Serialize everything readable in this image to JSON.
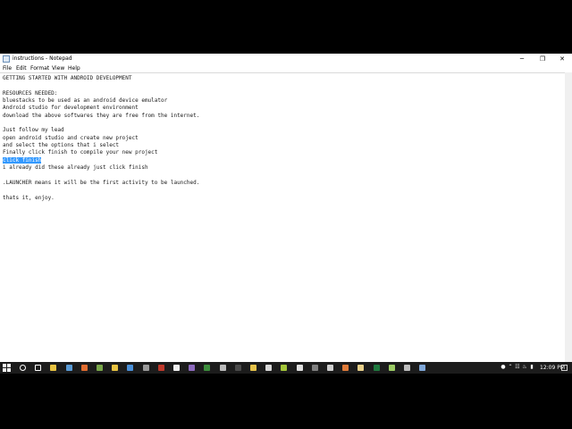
{
  "window": {
    "title": "instructions - Notepad",
    "controls": {
      "minimize": "─",
      "maximize": "❐",
      "close": "✕"
    }
  },
  "menu": {
    "file": "File",
    "edit": "Edit",
    "format": "Format",
    "view": "View",
    "help": "Help"
  },
  "document": {
    "lines": [
      "GETTING STARTED WITH ANDROID DEVELOPMENT",
      "",
      "RESOURCES NEEDED:",
      "bluestacks to be used as an android device emulator",
      "Android studio for development environment",
      "download the above softwares they are free from the internet.",
      "",
      "Just follow my lead",
      "open android studio and create new project",
      "and select the options that i select",
      "Finally click finish to compile your new project",
      "click finish",
      "i already did these already just click finish",
      "",
      ".LAUNCHER means it will be the first activity to be launched.",
      "",
      "thats it, enjoy."
    ],
    "selected_line_index": 11
  },
  "taskbar": {
    "clock": "12:09 PM",
    "colors": {
      "background": "#1c1c1c"
    },
    "icons": [
      "search-icon",
      "task-view-icon",
      "file-explorer-icon",
      "store-icon",
      "firefox-icon",
      "minecraft-icon",
      "folder-icon",
      "photos-icon",
      "calculator-icon",
      "media-icon",
      "app-icon",
      "visual-studio-icon",
      "terminal-icon",
      "settings-icon",
      "cmd-icon",
      "notes-icon",
      "files-icon",
      "android-icon",
      "paint-icon",
      "app2-icon",
      "console-icon",
      "java-icon",
      "android-studio-icon",
      "excel-icon",
      "image-icon",
      "camera-icon",
      "notepad-icon"
    ]
  }
}
